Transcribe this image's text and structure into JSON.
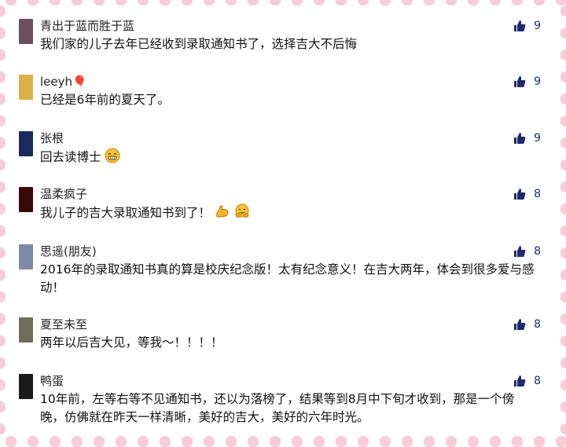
{
  "comments": [
    {
      "name": "青出于蓝而胜于蓝",
      "likes": "9",
      "text": "我们家的儿子去年已经收到录取通知书了，选择吉大不后悔",
      "avatar": "#6b4f5c"
    },
    {
      "name": "leeyh🎈",
      "likes": "9",
      "text": "已经是6年前的夏天了。",
      "avatar": "#d9b24a"
    },
    {
      "name": "张根",
      "likes": "9",
      "text": "回去读博士",
      "avatar": "#1a2a5c",
      "emoji": [
        "grin"
      ]
    },
    {
      "name": "温柔疯子",
      "likes": "8",
      "text": "我儿子的吉大录取通知书到了！",
      "avatar": "#3a0a0a",
      "emoji": [
        "muscle",
        "hug"
      ]
    },
    {
      "name": "思遥(朋友)",
      "likes": "8",
      "text": "2016年的录取通知书真的算是校庆纪念版！太有纪念意义！在吉大两年，体会到很多爱与感动！",
      "avatar": "#7e8aa8"
    },
    {
      "name": "夏至未至",
      "likes": "8",
      "text": "两年以后吉大见，等我～！！！！",
      "avatar": "#6e6e5a"
    },
    {
      "name": "鸭蛋",
      "likes": "8",
      "text": "10年前，左等右等不见通知书，还以为落榜了，结果等到8月中下旬才收到，那是一个傍晚，仿佛就在昨天一样清晰，美好的吉大，美好的六年时光。",
      "avatar": "#1a1a1a"
    }
  ],
  "icons": {
    "like": "thumbs-up-icon"
  },
  "colors": {
    "like": "#1e2a6b",
    "border": "#f8ccd8"
  }
}
